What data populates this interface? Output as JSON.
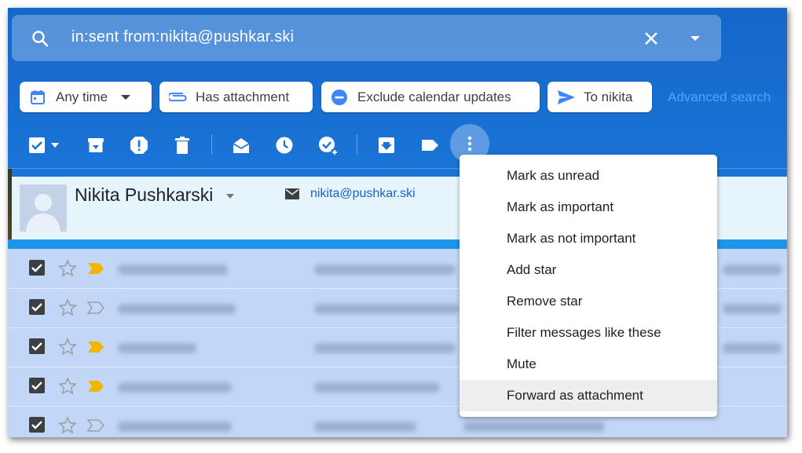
{
  "search": {
    "query": "in:sent from:nikita@pushkar.ski",
    "icons": [
      "search-icon",
      "clear-icon",
      "dropdown-arrow-icon"
    ]
  },
  "chips": [
    {
      "label": "Any time",
      "icon": "calendar-icon",
      "has_dropdown": true
    },
    {
      "label": "Has attachment",
      "icon": "paperclip-icon"
    },
    {
      "label": "Exclude calendar updates",
      "icon": "minus-circle-icon"
    },
    {
      "label": "To nikita",
      "icon": "send-icon"
    }
  ],
  "advanced_search": "Advanced search",
  "toolbar": {
    "icons": [
      "select-all-checkbox-icon",
      "select-dropdown-icon",
      "archive-icon",
      "report-spam-icon",
      "delete-icon",
      "mark-read-icon",
      "snooze-icon",
      "add-task-icon",
      "move-to-icon",
      "label-icon",
      "more-vert-icon"
    ]
  },
  "contact": {
    "name": "Nikita Pushkarski",
    "email": "nikita@pushkar.ski"
  },
  "rows": [
    {
      "checked": true,
      "important": true
    },
    {
      "checked": true,
      "important": false
    },
    {
      "checked": true,
      "important": true
    },
    {
      "checked": true,
      "important": true
    },
    {
      "checked": true,
      "important": false
    }
  ],
  "menu": {
    "items": [
      "Mark as unread",
      "Mark as important",
      "Mark as not important",
      "Add star",
      "Remove star",
      "Filter messages like these",
      "Mute",
      "Forward as attachment"
    ],
    "highlighted": "Forward as attachment"
  },
  "colors": {
    "background": "#1a73d6",
    "accent_blue": "#4285f4",
    "important_marker": "#f4b400",
    "link": "#4aa8ff"
  }
}
